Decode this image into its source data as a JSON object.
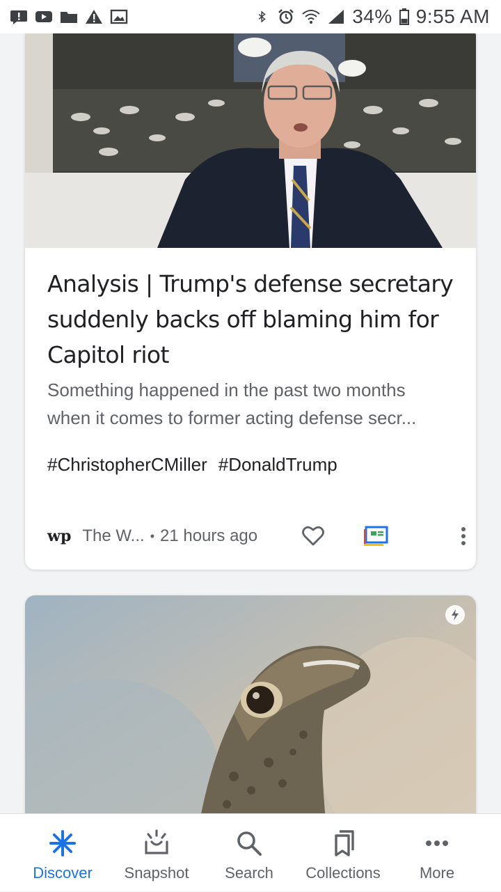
{
  "status_bar": {
    "battery": "34%",
    "time": "9:55 AM",
    "left_icons": [
      "message-notification-icon",
      "youtube-icon",
      "folder-icon",
      "warning-icon",
      "image-icon"
    ],
    "right_icons": [
      "bluetooth-icon",
      "alarm-icon",
      "wifi-icon",
      "signal-icon",
      "battery-icon"
    ]
  },
  "cards": [
    {
      "headline": "Analysis | Trump's defense secretary suddenly backs off blaming him for Capitol riot",
      "snippet_line1": "Something happened in the past two months",
      "snippet_line2": "when it comes to former acting defense secr...",
      "tags": [
        "#ChristopherCMiller",
        "#DonaldTrump"
      ],
      "publisher_logo": "wp",
      "publisher": "The W...",
      "separator": "•",
      "time_ago": "21 hours ago"
    },
    {
      "badge_icon": "amp-lightning-icon"
    }
  ],
  "bottom_nav": [
    {
      "label": "Discover",
      "active": true
    },
    {
      "label": "Snapshot",
      "active": false
    },
    {
      "label": "Search",
      "active": false
    },
    {
      "label": "Collections",
      "active": false
    },
    {
      "label": "More",
      "active": false
    }
  ],
  "colors": {
    "accent": "#1a73e8",
    "text_primary": "#202124",
    "text_secondary": "#5f6368",
    "background": "#f1f3f4"
  }
}
